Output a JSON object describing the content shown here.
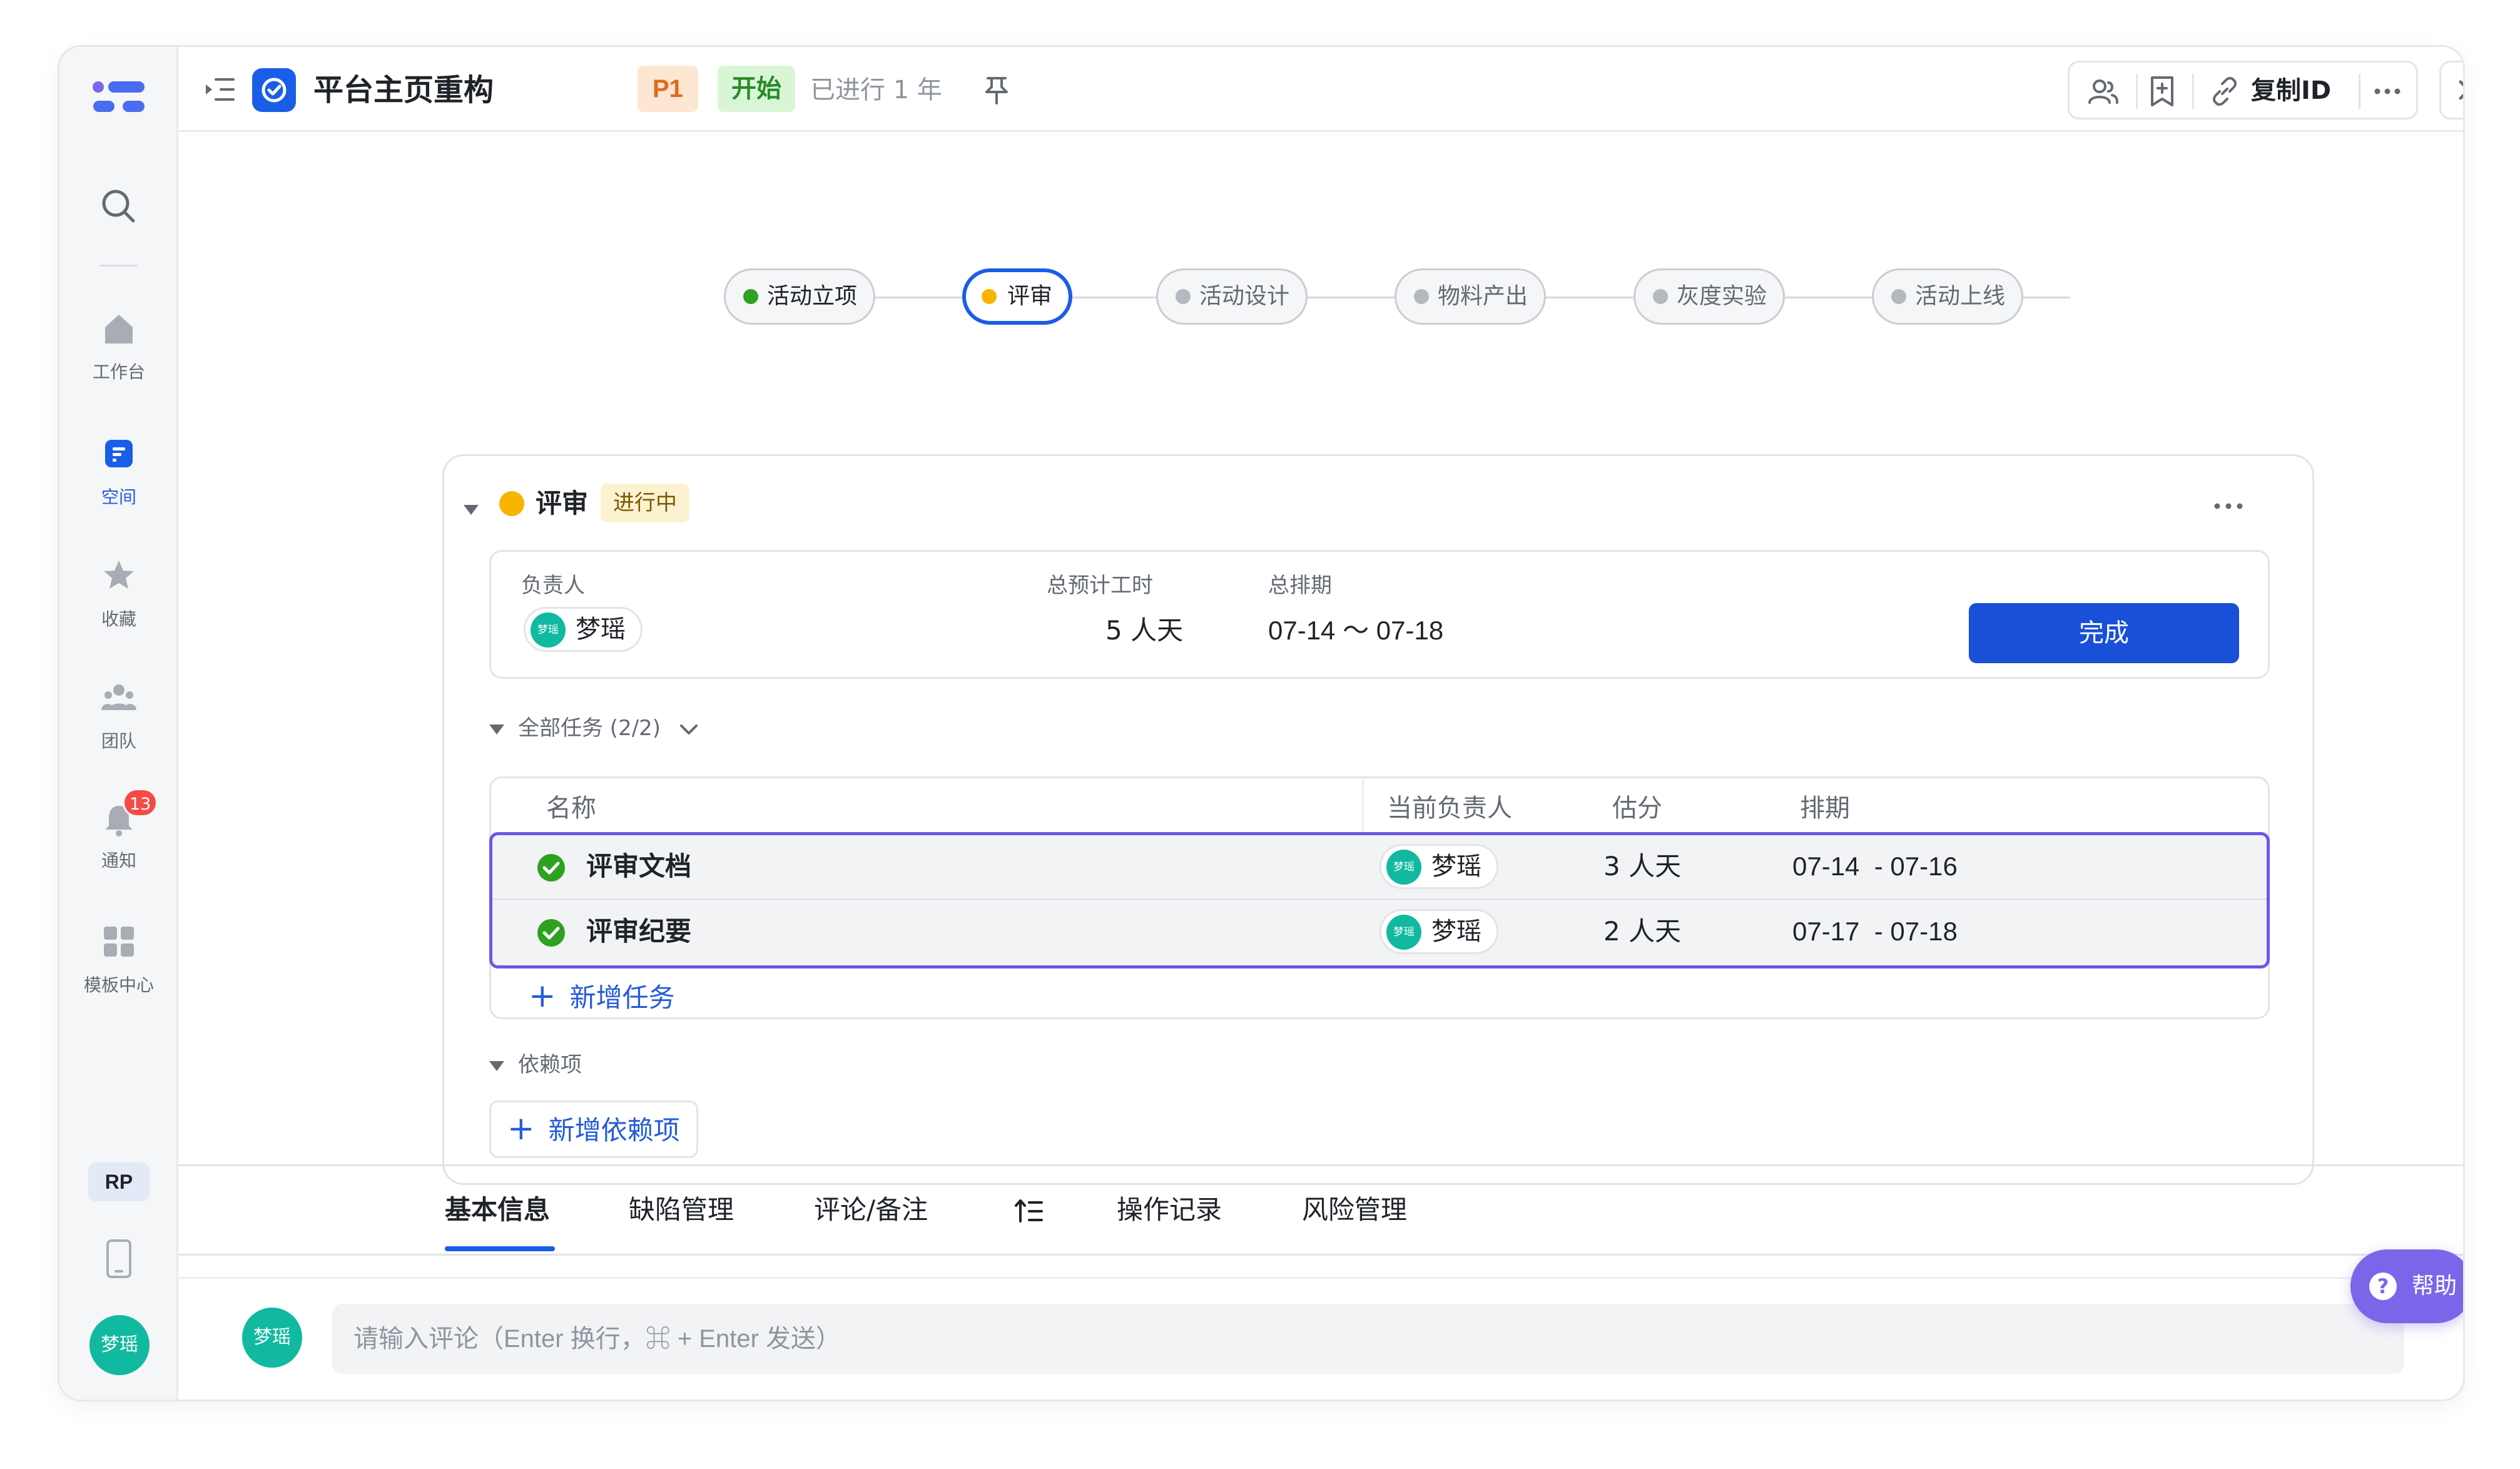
{
  "sidebar": {
    "items": [
      {
        "label": "工作台",
        "icon": "home-icon"
      },
      {
        "label": "空间",
        "icon": "space-icon",
        "active": true
      },
      {
        "label": "收藏",
        "icon": "star-icon"
      },
      {
        "label": "团队",
        "icon": "team-icon"
      },
      {
        "label": "通知",
        "icon": "bell-icon",
        "badge": "13"
      },
      {
        "label": "模板中心",
        "icon": "template-icon"
      }
    ],
    "rp_label": "RP",
    "user_avatar": "梦瑶"
  },
  "header": {
    "title": "平台主页重构",
    "priority": "P1",
    "status": "开始",
    "elapsed": "已进行 1 年",
    "copy_id_label": "复制ID"
  },
  "pipeline": {
    "stages": [
      {
        "label": "活动立项",
        "state": "done"
      },
      {
        "label": "评审",
        "state": "current"
      },
      {
        "label": "活动设计",
        "state": "todo"
      },
      {
        "label": "物料产出",
        "state": "todo"
      },
      {
        "label": "灰度实验",
        "state": "todo"
      },
      {
        "label": "活动上线",
        "state": "todo"
      }
    ]
  },
  "node": {
    "title": "评审",
    "status_tag": "进行中",
    "owner_label": "负责人",
    "owner": "梦瑶",
    "owner_avatar": "梦瑶",
    "hours_label": "总预计工时",
    "hours": "5 人天",
    "schedule_label": "总排期",
    "schedule": "07-14 ～ 07-18",
    "complete_label": "完成"
  },
  "tasks": {
    "section_label": "全部任务 (2/2)",
    "columns": [
      "名称",
      "当前负责人",
      "估分",
      "排期"
    ],
    "rows": [
      {
        "name": "评审文档",
        "assignee": "梦瑶",
        "avatar": "梦瑶",
        "estimate": "3 人天",
        "schedule": "07-14  - 07-16"
      },
      {
        "name": "评审纪要",
        "assignee": "梦瑶",
        "avatar": "梦瑶",
        "estimate": "2 人天",
        "schedule": "07-17  - 07-18"
      }
    ],
    "add_label": "新增任务"
  },
  "dependencies": {
    "section_label": "依赖项",
    "add_label": "新增依赖项"
  },
  "tabs": [
    "基本信息",
    "缺陷管理",
    "评论/备注",
    "操作记录",
    "风险管理"
  ],
  "comment": {
    "avatar": "梦瑶",
    "placeholder": "请输入评论（Enter 换行，⌘ + Enter 发送）"
  },
  "help_label": "帮助",
  "colors": {
    "primary": "#1a4fd8",
    "done_green": "#2ea121",
    "current_yellow": "#f7b500",
    "selection_border": "#6b57e8",
    "avatar_teal": "#10b9a0",
    "help_purple": "#7a66e8"
  }
}
